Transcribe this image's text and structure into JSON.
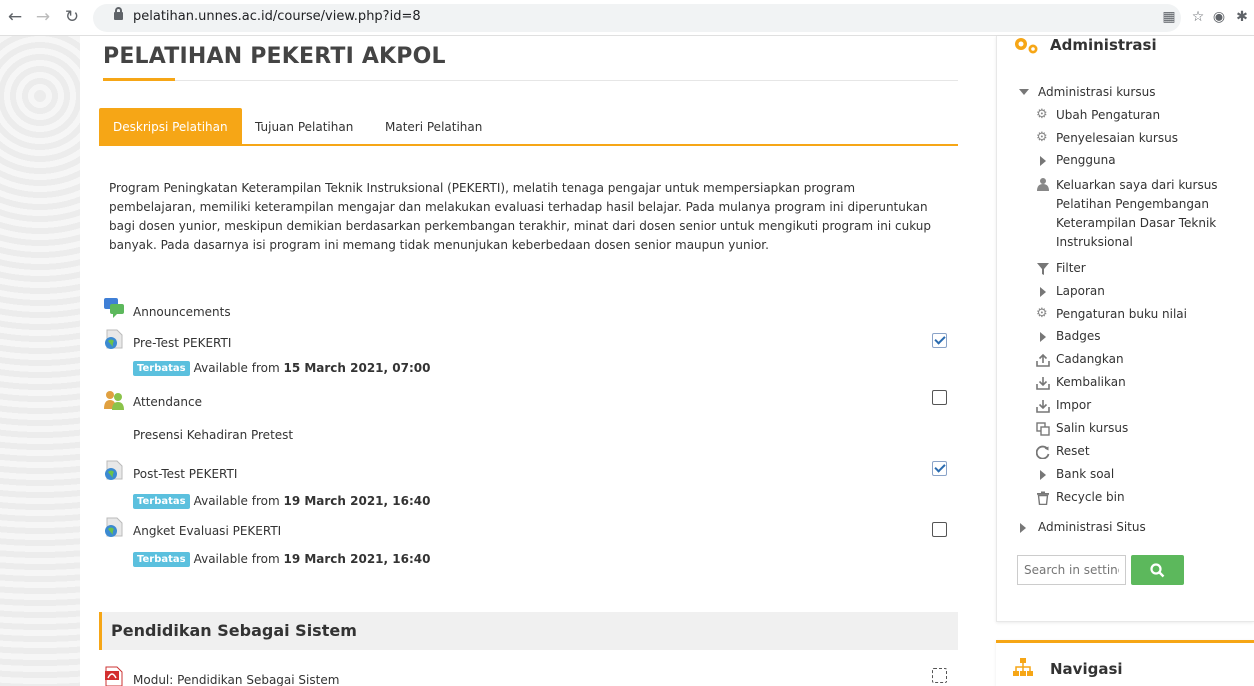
{
  "browser": {
    "url": "pelatihan.unnes.ac.id/course/view.php?id=8"
  },
  "course": {
    "title": "PELATIHAN PEKERTI AKPOL"
  },
  "tabs": [
    {
      "label": "Deskripsi Pelatihan",
      "active": true
    },
    {
      "label": "Tujuan Pelatihan",
      "active": false
    },
    {
      "label": "Materi Pelatihan",
      "active": false
    }
  ],
  "description": "Program Peningkatan Keterampilan Teknik Instruksional (PEKERTI), melatih tenaga pengajar untuk mempersiapkan program pembelajaran, memiliki keterampilan mengajar dan melakukan evaluasi terhadap hasil belajar. Pada mulanya program ini diperuntukan bagi dosen yunior, meskipun demikian berdasarkan perkembangan terakhir, minat dari dosen senior untuk mengikuti program ini cukup banyak. Pada dasarnya isi program ini memang tidak menunjukan keberbedaan dosen senior maupun yunior.",
  "activities": [
    {
      "label": "Announcements",
      "icon": "forum-icon"
    },
    {
      "label": "Pre-Test PEKERTI",
      "icon": "quiz-globe-icon",
      "completion": "done",
      "restriction": {
        "badge": "Terbatas",
        "text": "Available from ",
        "date": "15 March 2021, 07:00"
      }
    },
    {
      "label": "Attendance",
      "icon": "attendance-icon",
      "completion": "empty",
      "description": "Presensi Kehadiran Pretest"
    },
    {
      "label": "Post-Test PEKERTI",
      "icon": "quiz-globe-icon",
      "completion": "done",
      "restriction": {
        "badge": "Terbatas",
        "text": "Available from ",
        "date": "19 March 2021, 16:40"
      }
    },
    {
      "label": "Angket Evaluasi PEKERTI",
      "icon": "quiz-globe-icon",
      "completion": "empty",
      "restriction": {
        "badge": "Terbatas",
        "text": "Available from ",
        "date": "19 March 2021, 16:40"
      }
    }
  ],
  "section": {
    "title": "Pendidikan Sebagai Sistem",
    "items": [
      {
        "label": "Modul: Pendidikan Sebagai Sistem",
        "icon": "pdf-icon",
        "completion": "manual"
      }
    ]
  },
  "sidebar": {
    "title": "Administrasi",
    "course_admin": "Administrasi kursus",
    "items": [
      {
        "label": "Ubah Pengaturan",
        "icon": "gear-icon"
      },
      {
        "label": "Penyelesaian kursus",
        "icon": "gear-icon"
      },
      {
        "label": "Pengguna",
        "icon": "expand-icon"
      },
      {
        "label": "Keluarkan saya dari kursus Pelatihan Pengembangan Keterampilan Dasar Teknik Instruksional",
        "lines": [
          "Keluarkan saya dari kursus",
          "Pelatihan Pengembangan",
          "Keterampilan Dasar Teknik",
          "Instruksional"
        ],
        "icon": "user-icon"
      },
      {
        "label": "Filter",
        "icon": "filter-icon"
      },
      {
        "label": "Laporan",
        "icon": "expand-icon"
      },
      {
        "label": "Pengaturan buku nilai",
        "icon": "gear-icon"
      },
      {
        "label": "Badges",
        "icon": "expand-icon"
      },
      {
        "label": "Cadangkan",
        "icon": "upload-icon"
      },
      {
        "label": "Kembalikan",
        "icon": "download-icon"
      },
      {
        "label": "Impor",
        "icon": "import-icon"
      },
      {
        "label": "Salin kursus",
        "icon": "copy-icon"
      },
      {
        "label": "Reset",
        "icon": "reset-icon"
      },
      {
        "label": "Bank soal",
        "icon": "expand-icon"
      },
      {
        "label": "Recycle bin",
        "icon": "trash-icon"
      }
    ],
    "site_admin": "Administrasi Situs",
    "search_placeholder": "Search in settings"
  },
  "navigation": {
    "title": "Navigasi"
  },
  "colors": {
    "accent": "#f6a616",
    "badge": "#5bc0de",
    "search_button": "#5cb85c"
  }
}
